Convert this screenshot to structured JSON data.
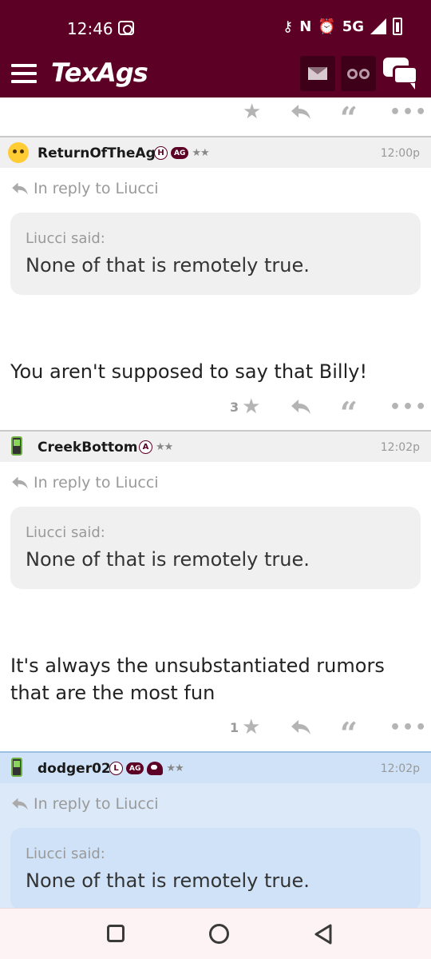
{
  "status_bar": {
    "time": "12:46",
    "network": "5G"
  },
  "header": {
    "logo": "TexAgs"
  },
  "actions": {
    "reply_symbol": "↩",
    "quote_symbol": "“",
    "more_symbol": "•••",
    "star_symbol": "★"
  },
  "posts": [
    {
      "username": "ReturnOfTheAg",
      "badges": [
        "H",
        "AG"
      ],
      "stars": "★★",
      "time": "12:00p",
      "reply_to": "In reply to Liucci",
      "quote_author": "Liucci said:",
      "quote_text": "None of that is remotely true.",
      "body": "You aren't supposed to say that Billy!",
      "star_count": "3"
    },
    {
      "username": "CreekBottom",
      "badges": [
        "A"
      ],
      "stars": "★★",
      "time": "12:02p",
      "reply_to": "In reply to Liucci",
      "quote_author": "Liucci said:",
      "quote_text": "None of that is remotely true.",
      "body": "It's always the unsubstantiated rumors that are the most fun",
      "star_count": "1"
    },
    {
      "username": "dodger02",
      "badges": [
        "L",
        "AG"
      ],
      "stars": "★★",
      "time": "12:02p",
      "reply_to": "In reply to Liucci",
      "quote_author": "Liucci said:",
      "quote_text": "None of that is remotely true."
    }
  ],
  "colors": {
    "brand": "#5c0025",
    "highlight": "#cfe2f7"
  }
}
